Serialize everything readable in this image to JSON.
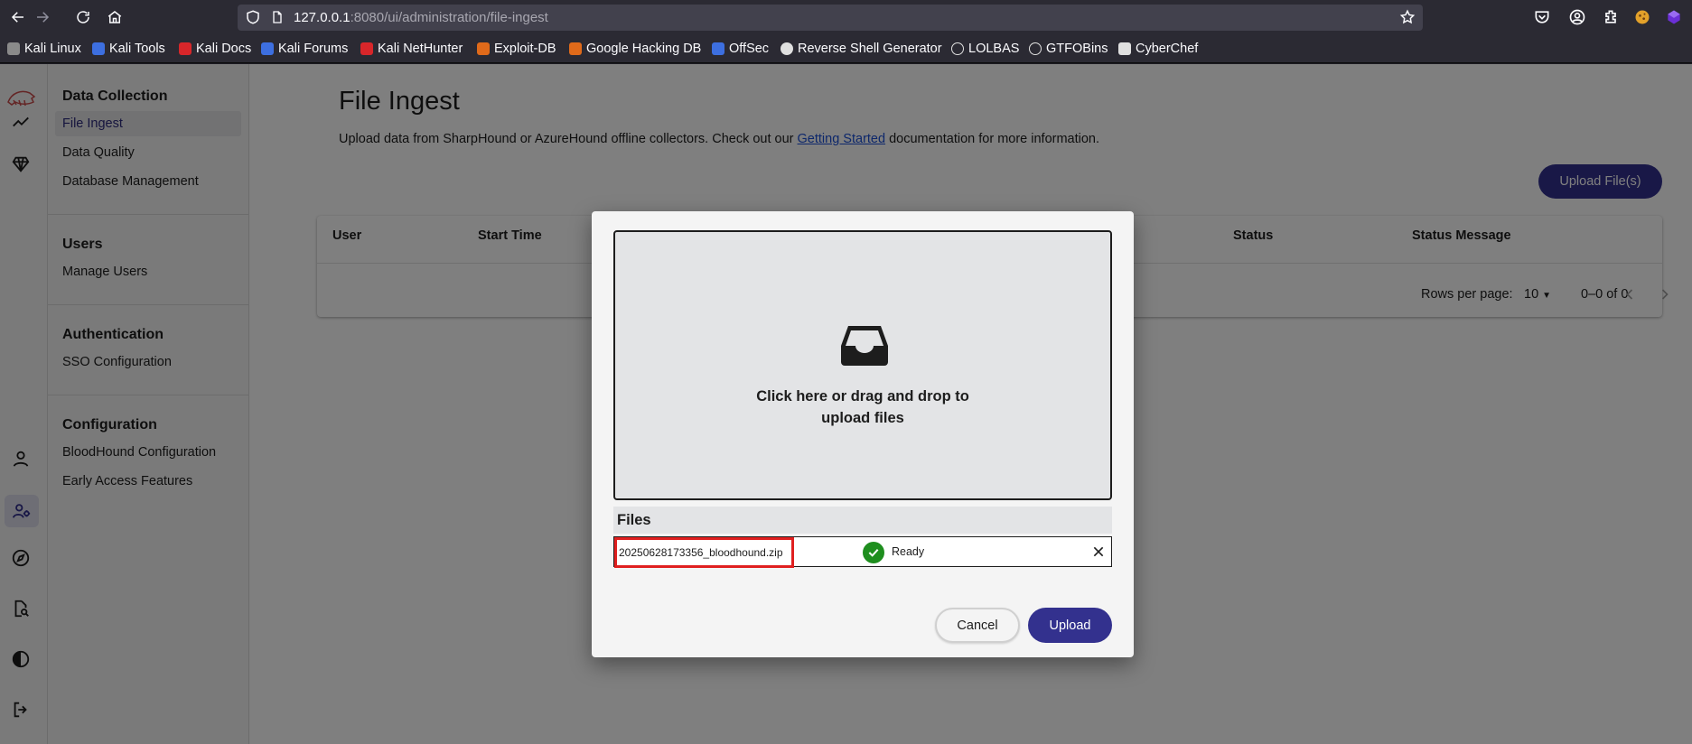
{
  "browser": {
    "url_host": "127.0.0.1",
    "url_rest": ":8080/ui/administration/file-ingest",
    "bookmarks": [
      {
        "label": "Kali Linux",
        "icon": "kali-dragon-icon",
        "color": "#1d1d1d"
      },
      {
        "label": "Kali Tools",
        "icon": "kali-tools-icon",
        "color": "#3d6fe0"
      },
      {
        "label": "Kali Docs",
        "icon": "kali-docs-icon",
        "color": "#d8262a"
      },
      {
        "label": "Kali Forums",
        "icon": "kali-forums-icon",
        "color": "#3d6fe0"
      },
      {
        "label": "Kali NetHunter",
        "icon": "nethunter-icon",
        "color": "#d8262a"
      },
      {
        "label": "Exploit-DB",
        "icon": "exploit-db-icon",
        "color": "#e06a1a"
      },
      {
        "label": "Google Hacking DB",
        "icon": "ghdb-icon",
        "color": "#e06a1a"
      },
      {
        "label": "OffSec",
        "icon": "offsec-icon",
        "color": "#3d6fe0"
      },
      {
        "label": "Reverse Shell Generator",
        "icon": "skull-icon",
        "color": "#e0e0e0"
      },
      {
        "label": "LOLBAS",
        "icon": "globe-icon",
        "color": "#e0e0e0"
      },
      {
        "label": "GTFOBins",
        "icon": "globe-icon",
        "color": "#e0e0e0"
      },
      {
        "label": "CyberChef",
        "icon": "chef-hat-icon",
        "color": "#e0e0e0"
      }
    ]
  },
  "sidebar": {
    "sections": [
      {
        "heading": "Data Collection",
        "items": [
          "File Ingest",
          "Data Quality",
          "Database Management"
        ]
      },
      {
        "heading": "Users",
        "items": [
          "Manage Users"
        ]
      },
      {
        "heading": "Authentication",
        "items": [
          "SSO Configuration"
        ]
      },
      {
        "heading": "Configuration",
        "items": [
          "BloodHound Configuration",
          "Early Access Features"
        ]
      }
    ],
    "active_item": "File Ingest"
  },
  "main": {
    "title": "File Ingest",
    "description_before": "Upload data from SharpHound or AzureHound offline collectors. Check out our ",
    "description_link": "Getting Started",
    "description_after": " documentation for more information.",
    "upload_button": "Upload File(s)",
    "table": {
      "columns": [
        "User",
        "Start Time",
        "Status",
        "Status Message"
      ],
      "rows_per_page_label": "Rows per page:",
      "rows_per_page": "10",
      "range": "0–0 of 0"
    }
  },
  "modal": {
    "dropzone_line1": "Click here or drag and drop to",
    "dropzone_line2": "upload files",
    "files_heading": "Files",
    "files": [
      {
        "name": "20250628173356_bloodhound.zip",
        "status": "Ready"
      }
    ],
    "cancel_label": "Cancel",
    "upload_label": "Upload"
  },
  "colors": {
    "brand": "#33318e",
    "ready": "#1e8e1e",
    "highlight": "#e02020"
  }
}
